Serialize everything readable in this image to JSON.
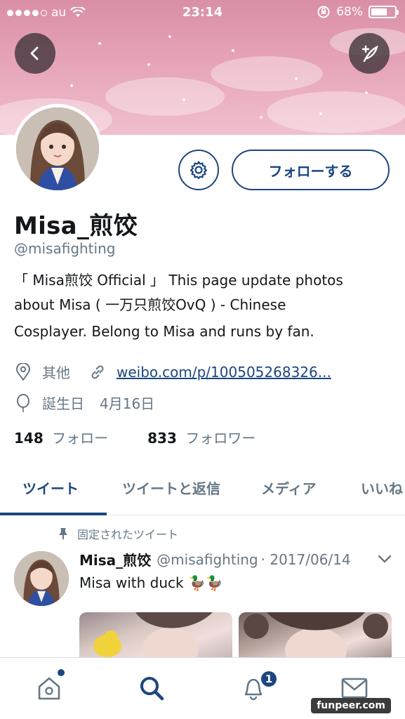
{
  "status_bar": {
    "carrier": "au",
    "time": "23:14",
    "battery_percent": "68%",
    "battery_level": 0.68
  },
  "profile": {
    "display_name": "Misa_煎饺",
    "handle": "@misafighting",
    "follow_button": "フォローする",
    "bio_lines": [
      "「 Misa煎饺 Official 」 This page update photos",
      "about Misa ( 一万只煎饺OvQ ) - Chinese",
      "Cosplayer. Belong to Misa and runs by fan."
    ],
    "location": "其他",
    "website": "weibo.com/p/100505268326...",
    "birthday_label": "誕生日",
    "birthday": "4月16日",
    "following_count": "148",
    "following_label": "フォロー",
    "followers_count": "833",
    "followers_label": "フォロワー"
  },
  "tabs": [
    {
      "label": "ツイート",
      "active": true
    },
    {
      "label": "ツイートと返信",
      "active": false
    },
    {
      "label": "メディア",
      "active": false
    },
    {
      "label": "いいね",
      "active": false
    }
  ],
  "pinned_label": "固定されたツイート",
  "tweet": {
    "name": "Misa_煎饺",
    "handle": "@misafighting",
    "date": "· 2017/06/14",
    "text": "Misa with duck 🦆🦆"
  },
  "nav": {
    "notification_badge": "1"
  },
  "watermark": "funpeer.com",
  "colors": {
    "accent": "#1b4680",
    "banner": "#e6a3b8",
    "secondary_text": "#657786"
  }
}
